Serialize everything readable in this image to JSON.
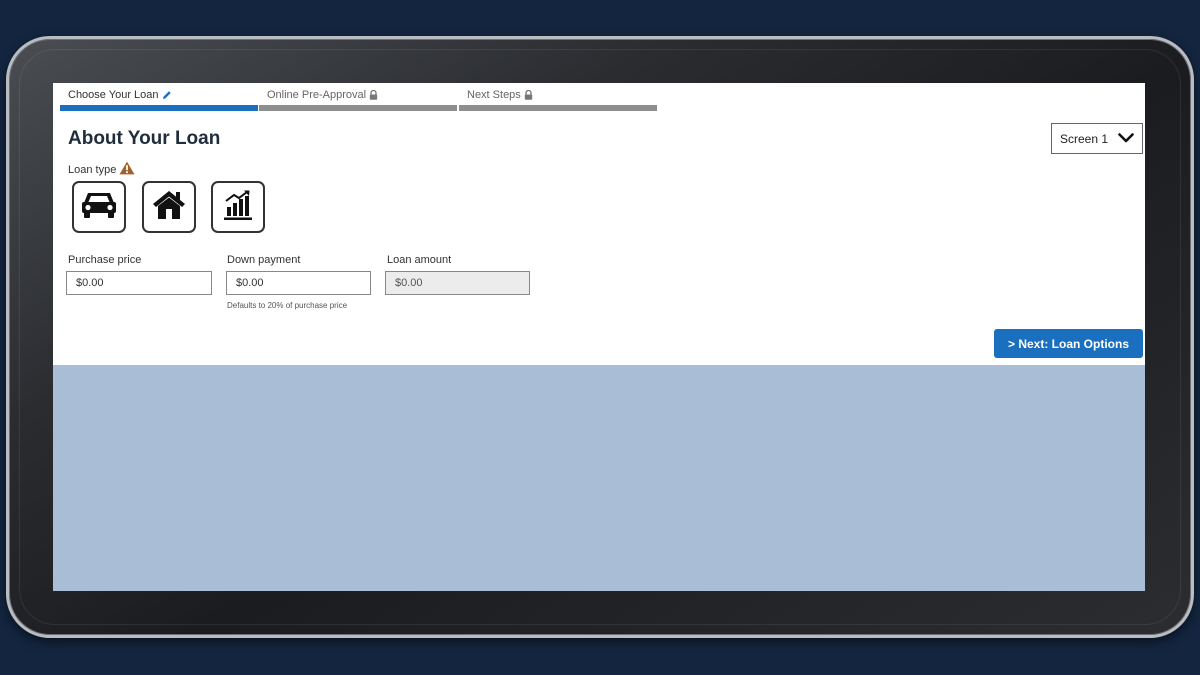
{
  "steps": [
    {
      "label": "Choose Your Loan",
      "icon": "pencil-icon",
      "state": "active"
    },
    {
      "label": "Online Pre-Approval",
      "icon": "lock-icon",
      "state": "locked"
    },
    {
      "label": "Next Steps",
      "icon": "lock-icon",
      "state": "locked"
    }
  ],
  "page_title": "About Your Loan",
  "screen_select": {
    "value": "Screen 1",
    "icon": "chevron-down-icon"
  },
  "loan_type": {
    "label": "Loan type",
    "warning_icon": "warning-icon",
    "options": [
      {
        "icon": "car-icon"
      },
      {
        "icon": "house-icon"
      },
      {
        "icon": "chart-icon"
      }
    ]
  },
  "fields": {
    "purchase_price": {
      "label": "Purchase price",
      "value": "$0.00"
    },
    "down_payment": {
      "label": "Down payment",
      "value": "$0.00",
      "hint": "Defaults to 20% of purchase price"
    },
    "loan_amount": {
      "label": "Loan amount",
      "value": "$0.00"
    }
  },
  "next_button": {
    "label": "> Next: Loan Options"
  },
  "colors": {
    "accent": "#1b6fbf",
    "warning": "#a0622d",
    "background": "#13253f",
    "lower_panel": "#a9bdd7"
  }
}
